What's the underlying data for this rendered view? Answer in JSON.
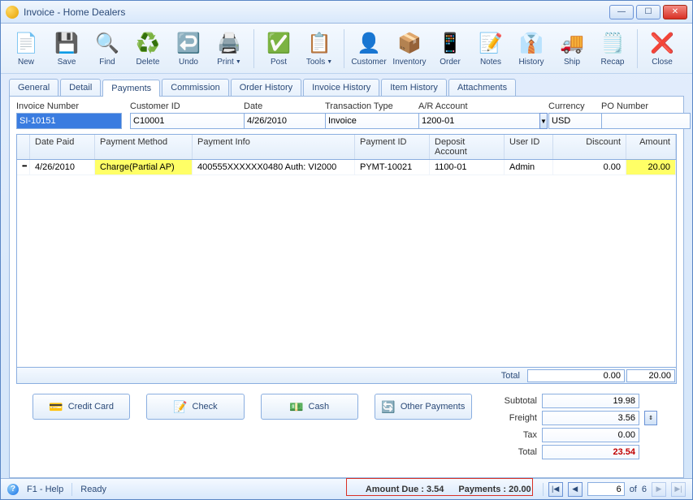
{
  "title": "Invoice - Home Dealers",
  "toolbar": [
    {
      "label": "New",
      "icon": "📄"
    },
    {
      "label": "Save",
      "icon": "💾"
    },
    {
      "label": "Find",
      "icon": "🔍"
    },
    {
      "label": "Delete",
      "icon": "♻️"
    },
    {
      "label": "Undo",
      "icon": "↩️"
    },
    {
      "label": "Print",
      "icon": "🖨️"
    },
    {
      "label": "Post",
      "icon": "✅"
    },
    {
      "label": "Tools",
      "icon": "📋"
    },
    {
      "label": "Customer",
      "icon": "👤"
    },
    {
      "label": "Inventory",
      "icon": "📦"
    },
    {
      "label": "Order",
      "icon": "📱"
    },
    {
      "label": "Notes",
      "icon": "📝"
    },
    {
      "label": "History",
      "icon": "👔"
    },
    {
      "label": "Ship",
      "icon": "🚚"
    },
    {
      "label": "Recap",
      "icon": "🗒️"
    },
    {
      "label": "Close",
      "icon": "❌"
    }
  ],
  "tabs": [
    "General",
    "Detail",
    "Payments",
    "Commission",
    "Order History",
    "Invoice History",
    "Item History",
    "Attachments"
  ],
  "active_tab": "Payments",
  "form": {
    "invoice_number_label": "Invoice Number",
    "invoice_number": "SI-10151",
    "customer_id_label": "Customer ID",
    "customer_id": "C10001",
    "date_label": "Date",
    "date": "4/26/2010",
    "transaction_type_label": "Transaction Type",
    "transaction_type": "Invoice",
    "ar_account_label": "A/R Account",
    "ar_account": "1200-01",
    "currency_label": "Currency",
    "currency": "USD",
    "po_number_label": "PO Number",
    "po_number": ""
  },
  "grid": {
    "columns": [
      "",
      "Date Paid",
      "Payment Method",
      "Payment Info",
      "Payment ID",
      "Deposit Account",
      "User ID",
      "Discount",
      "Amount"
    ],
    "rows": [
      {
        "date_paid": "4/26/2010",
        "method": "Charge(Partial AP)",
        "info": "400555XXXXXX0480 Auth: VI2000",
        "payment_id": "PYMT-10021",
        "deposit": "1100-01",
        "user": "Admin",
        "discount": "0.00",
        "amount": "20.00"
      }
    ],
    "total_label": "Total",
    "total_discount": "0.00",
    "total_amount": "20.00"
  },
  "buttons": {
    "credit_card": "Credit Card",
    "check": "Check",
    "cash": "Cash",
    "other": "Other Payments"
  },
  "totals": {
    "subtotal_label": "Subtotal",
    "subtotal": "19.98",
    "freight_label": "Freight",
    "freight": "3.56",
    "tax_label": "Tax",
    "tax": "0.00",
    "total_label": "Total",
    "total": "23.54"
  },
  "status": {
    "help": "F1 - Help",
    "ready": "Ready",
    "amount_due": "Amount Due : 3.54",
    "payments": "Payments : 20.00",
    "page": "6",
    "of_label": "of",
    "total_pages": "6"
  }
}
